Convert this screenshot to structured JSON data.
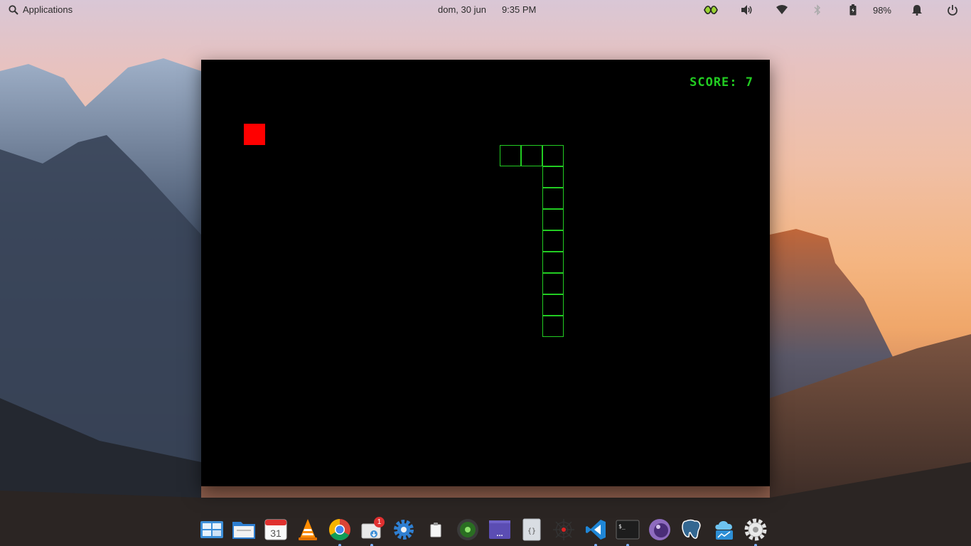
{
  "panel": {
    "applications_label": "Applications",
    "date": "dom, 30 jun",
    "time": "9:35 PM",
    "battery_percent": "98%",
    "indicators": [
      "app-indicator-icon",
      "volume-icon",
      "wifi-icon",
      "bluetooth-icon",
      "battery-icon",
      "notifications-icon",
      "power-icon"
    ]
  },
  "game": {
    "score_text": "SCORE: 7",
    "colors": {
      "snake": "#22cc22",
      "food": "#ff0000",
      "background": "#000000"
    },
    "snake_cells": [
      [
        14,
        4
      ],
      [
        15,
        4
      ],
      [
        16,
        4
      ],
      [
        16,
        5
      ],
      [
        16,
        6
      ],
      [
        16,
        7
      ],
      [
        16,
        8
      ],
      [
        16,
        9
      ],
      [
        16,
        10
      ],
      [
        16,
        11
      ],
      [
        16,
        12
      ]
    ],
    "food_cell": [
      2,
      3
    ]
  },
  "dock": {
    "items": [
      {
        "name": "multitasking-view-icon"
      },
      {
        "name": "files-icon"
      },
      {
        "name": "calendar-icon",
        "label": "31"
      },
      {
        "name": "vlc-icon"
      },
      {
        "name": "chrome-icon"
      },
      {
        "name": "appcenter-icon",
        "badge": "1"
      },
      {
        "name": "system-settings-gear-icon"
      },
      {
        "name": "clipboard-icon"
      },
      {
        "name": "green-orb-icon"
      },
      {
        "name": "purple-terminal-icon",
        "label": "..."
      },
      {
        "name": "code-editor-icon",
        "label": "{}"
      },
      {
        "name": "spider-web-icon"
      },
      {
        "name": "vscode-icon"
      },
      {
        "name": "terminal-icon",
        "label": "$_"
      },
      {
        "name": "purple-orb-icon"
      },
      {
        "name": "postgresql-elephant-icon"
      },
      {
        "name": "cloud-app-icon"
      },
      {
        "name": "settings-gear-icon"
      }
    ]
  }
}
